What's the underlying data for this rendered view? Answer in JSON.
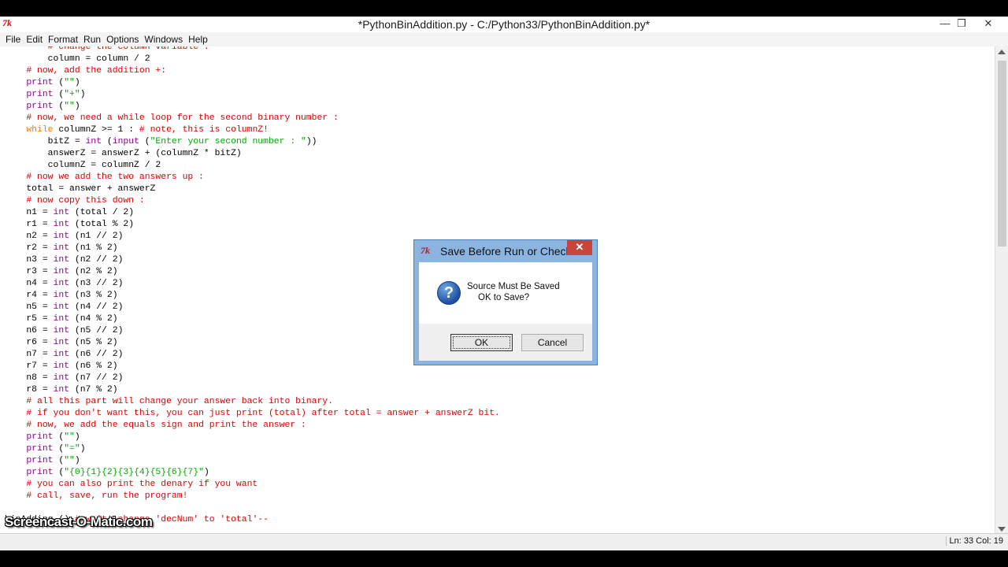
{
  "window": {
    "logo": "7k",
    "title": "*PythonBinAddition.py - C:/Python33/PythonBinAddition.py*",
    "minimize": "—",
    "maximize": "❐",
    "close": "✕"
  },
  "menu": [
    "File",
    "Edit",
    "Format",
    "Run",
    "Options",
    "Windows",
    "Help"
  ],
  "code": [
    [
      [
        "        # change the column variable :",
        "comment"
      ]
    ],
    [
      [
        "        column = column / 2",
        "plain"
      ]
    ],
    [
      [
        "    # now, add the addition +:",
        "comment"
      ]
    ],
    [
      [
        "    ",
        "plain"
      ],
      [
        "print",
        "builtin"
      ],
      [
        " (",
        "plain"
      ],
      [
        "\"\"",
        "string"
      ],
      [
        ")",
        "plain"
      ]
    ],
    [
      [
        "    ",
        "plain"
      ],
      [
        "print",
        "builtin"
      ],
      [
        " (",
        "plain"
      ],
      [
        "\"+\"",
        "string"
      ],
      [
        ")",
        "plain"
      ]
    ],
    [
      [
        "    ",
        "plain"
      ],
      [
        "print",
        "builtin"
      ],
      [
        " (",
        "plain"
      ],
      [
        "\"\"",
        "string"
      ],
      [
        ")",
        "plain"
      ]
    ],
    [
      [
        "    # now, we need a while loop for the second binary number :",
        "comment"
      ]
    ],
    [
      [
        "    ",
        "plain"
      ],
      [
        "while",
        "keyword"
      ],
      [
        " columnZ >= 1 : ",
        "plain"
      ],
      [
        "# note, this is columnZ!",
        "comment"
      ]
    ],
    [
      [
        "        bitZ = ",
        "plain"
      ],
      [
        "int",
        "builtin"
      ],
      [
        " (",
        "plain"
      ],
      [
        "input",
        "builtin"
      ],
      [
        " (",
        "plain"
      ],
      [
        "\"Enter your second number : \"",
        "string"
      ],
      [
        "))",
        "plain"
      ]
    ],
    [
      [
        "        answerZ = answerZ + (columnZ * bitZ)",
        "plain"
      ]
    ],
    [
      [
        "        columnZ = columnZ / 2",
        "plain"
      ]
    ],
    [
      [
        "    # now we add the two answers up :",
        "comment"
      ]
    ],
    [
      [
        "    total = answer + answerZ",
        "plain"
      ]
    ],
    [
      [
        "    # now copy this down :",
        "comment"
      ]
    ],
    [
      [
        "    n1 = ",
        "plain"
      ],
      [
        "int",
        "builtin"
      ],
      [
        " (total / 2)",
        "plain"
      ]
    ],
    [
      [
        "    r1 = ",
        "plain"
      ],
      [
        "int",
        "builtin"
      ],
      [
        " (total % 2)",
        "plain"
      ]
    ],
    [
      [
        "    n2 = ",
        "plain"
      ],
      [
        "int",
        "builtin"
      ],
      [
        " (n1 // 2)",
        "plain"
      ]
    ],
    [
      [
        "    r2 = ",
        "plain"
      ],
      [
        "int",
        "builtin"
      ],
      [
        " (n1 % 2)",
        "plain"
      ]
    ],
    [
      [
        "    n3 = ",
        "plain"
      ],
      [
        "int",
        "builtin"
      ],
      [
        " (n2 // 2)",
        "plain"
      ]
    ],
    [
      [
        "    r3 = ",
        "plain"
      ],
      [
        "int",
        "builtin"
      ],
      [
        " (n2 % 2)",
        "plain"
      ]
    ],
    [
      [
        "    n4 = ",
        "plain"
      ],
      [
        "int",
        "builtin"
      ],
      [
        " (n3 // 2)",
        "plain"
      ]
    ],
    [
      [
        "    r4 = ",
        "plain"
      ],
      [
        "int",
        "builtin"
      ],
      [
        " (n3 % 2)",
        "plain"
      ]
    ],
    [
      [
        "    n5 = ",
        "plain"
      ],
      [
        "int",
        "builtin"
      ],
      [
        " (n4 // 2)",
        "plain"
      ]
    ],
    [
      [
        "    r5 = ",
        "plain"
      ],
      [
        "int",
        "builtin"
      ],
      [
        " (n4 % 2)",
        "plain"
      ]
    ],
    [
      [
        "    n6 = ",
        "plain"
      ],
      [
        "int",
        "builtin"
      ],
      [
        " (n5 // 2)",
        "plain"
      ]
    ],
    [
      [
        "    r6 = ",
        "plain"
      ],
      [
        "int",
        "builtin"
      ],
      [
        " (n5 % 2)",
        "plain"
      ]
    ],
    [
      [
        "    n7 = ",
        "plain"
      ],
      [
        "int",
        "builtin"
      ],
      [
        " (n6 // 2)",
        "plain"
      ]
    ],
    [
      [
        "    r7 = ",
        "plain"
      ],
      [
        "int",
        "builtin"
      ],
      [
        " (n6 % 2)",
        "plain"
      ]
    ],
    [
      [
        "    n8 = ",
        "plain"
      ],
      [
        "int",
        "builtin"
      ],
      [
        " (n7 // 2)",
        "plain"
      ]
    ],
    [
      [
        "    r8 = ",
        "plain"
      ],
      [
        "int",
        "builtin"
      ],
      [
        " (n7 % 2)",
        "plain"
      ]
    ],
    [
      [
        "    # all this part will change your answer back into binary.",
        "comment"
      ]
    ],
    [
      [
        "    # if you don't want this, you can just print (total) after total = answer + answerZ bit.",
        "comment"
      ]
    ],
    [
      [
        "    # now, we add the equals sign and print the answer :",
        "comment"
      ]
    ],
    [
      [
        "    ",
        "plain"
      ],
      [
        "print",
        "builtin"
      ],
      [
        " (",
        "plain"
      ],
      [
        "\"\"",
        "string"
      ],
      [
        ")",
        "plain"
      ]
    ],
    [
      [
        "    ",
        "plain"
      ],
      [
        "print",
        "builtin"
      ],
      [
        " (",
        "plain"
      ],
      [
        "\"=\"",
        "string"
      ],
      [
        ")",
        "plain"
      ]
    ],
    [
      [
        "    ",
        "plain"
      ],
      [
        "print",
        "builtin"
      ],
      [
        " (",
        "plain"
      ],
      [
        "\"\"",
        "string"
      ],
      [
        ")",
        "plain"
      ]
    ],
    [
      [
        "    ",
        "plain"
      ],
      [
        "print",
        "builtin"
      ],
      [
        " (",
        "plain"
      ],
      [
        "\"{0}{1}{2}{3}{4}{5}{6}{7}\"",
        "string"
      ],
      [
        ")",
        "plain"
      ]
    ],
    [
      [
        "    # you can also print the denary if you want",
        "comment"
      ]
    ],
    [
      [
        "    # call, save, run the program!",
        "comment"
      ]
    ],
    [
      [
        "",
        "plain"
      ]
    ],
    [
      [
        "binAdding () ",
        "plain"
      ],
      [
        "# wait! change 'decNum' to 'total'--",
        "comment"
      ]
    ]
  ],
  "status": "Ln: 33 Col: 19",
  "watermark": "Screencast-O-Matic.com",
  "dialog": {
    "logo": "7k",
    "title": "Save Before Run or Check",
    "close": "✕",
    "icon": "question-icon",
    "icon_glyph": "?",
    "message_line1": "Source Must Be Saved",
    "message_line2": "OK to Save?",
    "ok_label": "OK",
    "cancel_label": "Cancel"
  },
  "colors": {
    "comment": "#dd0000",
    "builtin": "#900090",
    "keyword": "#ff7700",
    "string": "#00aa00"
  }
}
